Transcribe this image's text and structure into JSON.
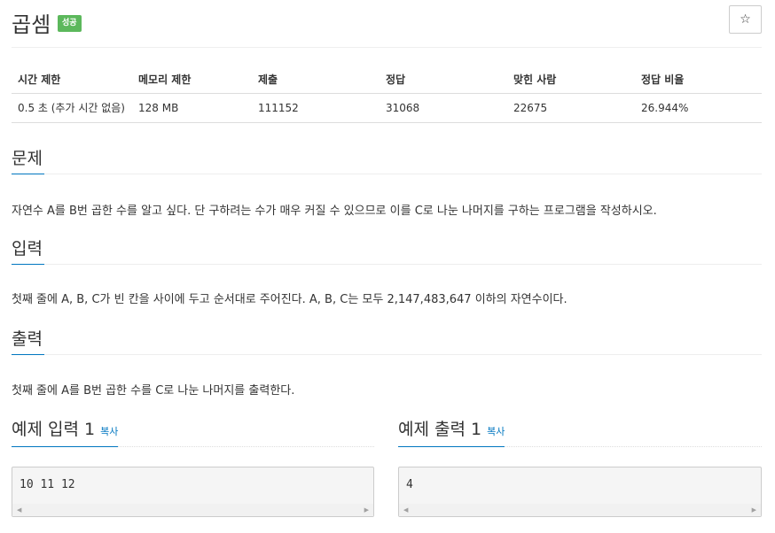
{
  "problem": {
    "title": "곱셈",
    "badge": "성공",
    "star": "☆"
  },
  "info_table": {
    "headers": [
      "시간 제한",
      "메모리 제한",
      "제출",
      "정답",
      "맞힌 사람",
      "정답 비율"
    ],
    "values": [
      "0.5 초 (추가 시간 없음)",
      "128 MB",
      "111152",
      "31068",
      "22675",
      "26.944%"
    ]
  },
  "sections": {
    "problem": {
      "heading": "문제",
      "text": "자연수 A를 B번 곱한 수를 알고 싶다. 단 구하려는 수가 매우 커질 수 있으므로 이를 C로 나눈 나머지를 구하는 프로그램을 작성하시오."
    },
    "input": {
      "heading": "입력",
      "text": "첫째 줄에 A, B, C가 빈 칸을 사이에 두고 순서대로 주어진다. A, B, C는 모두 2,147,483,647 이하의 자연수이다."
    },
    "output": {
      "heading": "출력",
      "text": "첫째 줄에 A를 B번 곱한 수를 C로 나눈 나머지를 출력한다."
    }
  },
  "samples": {
    "input": {
      "heading": "예제 입력 1",
      "copy": "복사",
      "content": "10 11 12"
    },
    "output": {
      "heading": "예제 출력 1",
      "copy": "복사",
      "content": "4"
    }
  },
  "icons": {
    "scroll_left": "◀",
    "scroll_right": "▶"
  },
  "colors": {
    "badge": "#5cb85c",
    "link": "#0076c0"
  }
}
